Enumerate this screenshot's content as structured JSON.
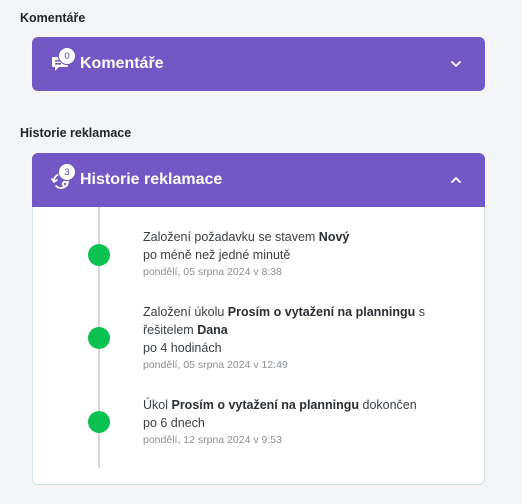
{
  "comments": {
    "section_title": "Komentáře",
    "header_title": "Komentáře",
    "badge_count": "0",
    "expanded": false
  },
  "history": {
    "section_title": "Historie reklamace",
    "header_title": "Historie reklamace",
    "badge_count": "3",
    "expanded": true,
    "events": [
      {
        "text_before": "Založení požadavku se stavem ",
        "bold": "Nový",
        "duration": "po méně než jedné minutě",
        "timestamp": "pondělí, 05 srpna 2024 v 8:38"
      },
      {
        "text_before": "Založení úkolu ",
        "bold": "Prosím o vytažení na planningu",
        "text_middle": " s řešitelem ",
        "bold2": "Dana",
        "duration": "po 4 hodinách",
        "timestamp": "pondělí, 05 srpna 2024 v 12:49"
      },
      {
        "text_before": "Úkol ",
        "bold": "Prosím o vytažení na planningu",
        "text_after": " dokončen",
        "duration": "po 6 dnech",
        "timestamp": "pondělí, 12 srpna 2024 v 9:53"
      }
    ]
  },
  "colors": {
    "header_bg": "#7357c4",
    "dot": "#0bc150",
    "timeline": "#d6d6d6"
  }
}
